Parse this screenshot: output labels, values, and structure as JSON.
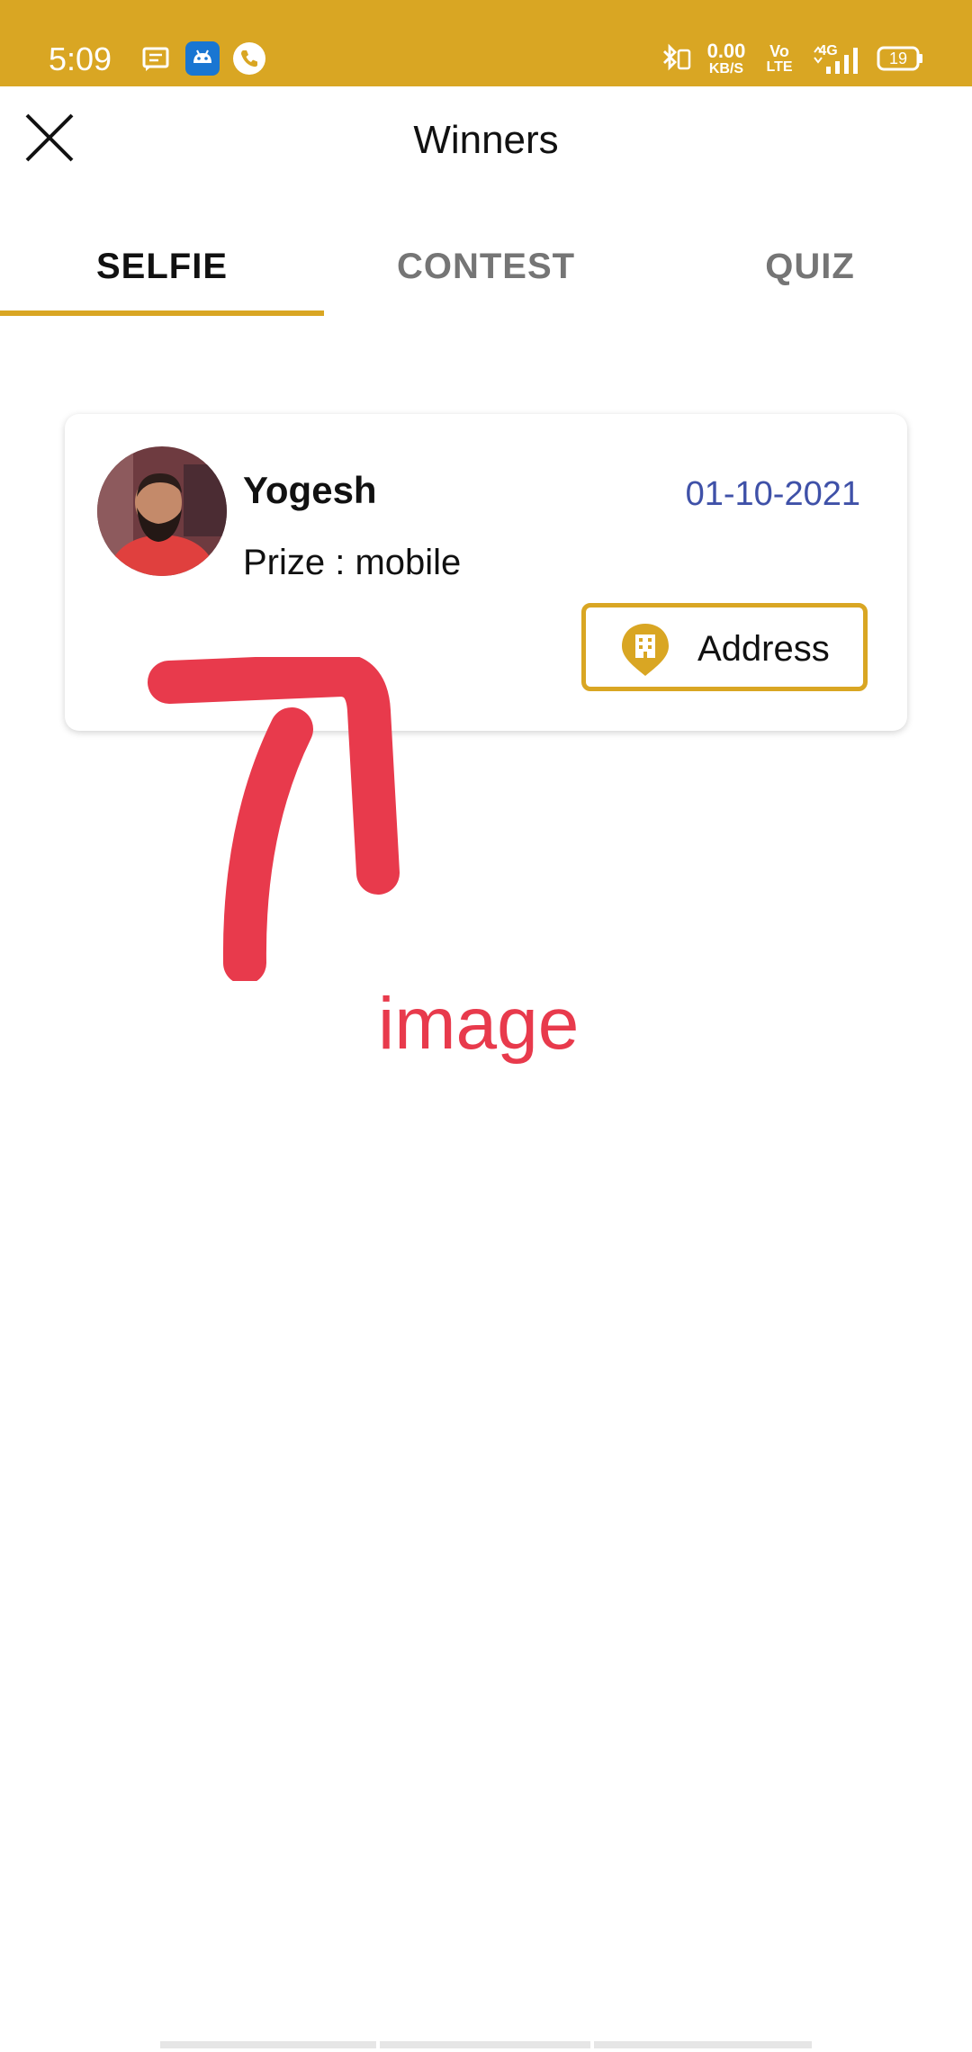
{
  "status_bar": {
    "time": "5:09",
    "network_speed_value": "0.00",
    "network_speed_unit": "KB/S",
    "volte_top": "Vo",
    "volte_bottom": "LTE",
    "network_type": "4G",
    "battery_level": "19",
    "icons": [
      "message-icon",
      "android-icon",
      "phone-icon",
      "bluetooth-icon",
      "signal-icon",
      "battery-icon"
    ],
    "bar_color": "#d9a623"
  },
  "app_bar": {
    "title": "Winners"
  },
  "tabs": [
    {
      "label": "SELFIE",
      "active": true
    },
    {
      "label": "CONTEST",
      "active": false
    },
    {
      "label": "QUIZ",
      "active": false
    }
  ],
  "winners": [
    {
      "name": "Yogesh",
      "date": "01-10-2021",
      "prize": "Prize : mobile",
      "address_button": "Address"
    }
  ],
  "annotation": {
    "text": "image",
    "color": "#e83a4c"
  },
  "theme": {
    "accent": "#d9a623",
    "date_color": "#3f51a8"
  }
}
